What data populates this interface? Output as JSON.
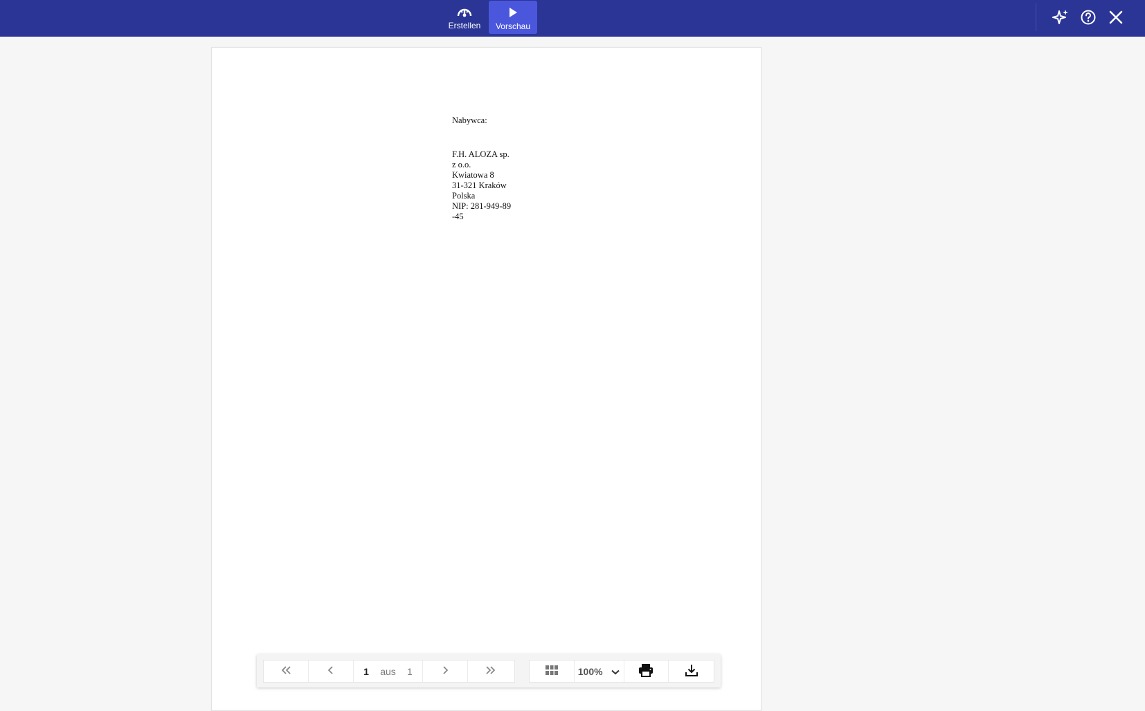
{
  "topbar": {
    "modes": [
      {
        "label": "Erstellen",
        "icon": "create-gauge-icon"
      },
      {
        "label": "Vorschau",
        "icon": "play-icon",
        "active": true
      }
    ],
    "actions": [
      {
        "icon": "sparkle-icon"
      },
      {
        "icon": "help-icon"
      },
      {
        "icon": "close-icon"
      }
    ],
    "colors": {
      "bar": "#2a3596",
      "active": "#4a57dc"
    }
  },
  "document": {
    "buyer_label": "Nabywca:",
    "buyer_lines": [
      "F.H. ALOZA sp.",
      "z o.o.",
      "Kwiatowa 8",
      "31-321 Kraków",
      "Polska",
      "NIP: 281-949-89",
      "-45"
    ]
  },
  "pager": {
    "current_page": "1",
    "of_label": "aus",
    "total_pages": "1",
    "zoom": "100%",
    "icons": [
      "first-page-icon",
      "prev-page-icon",
      "next-page-icon",
      "last-page-icon",
      "grid-view-icon",
      "zoom-dropdown-icon",
      "print-icon",
      "download-icon"
    ]
  }
}
